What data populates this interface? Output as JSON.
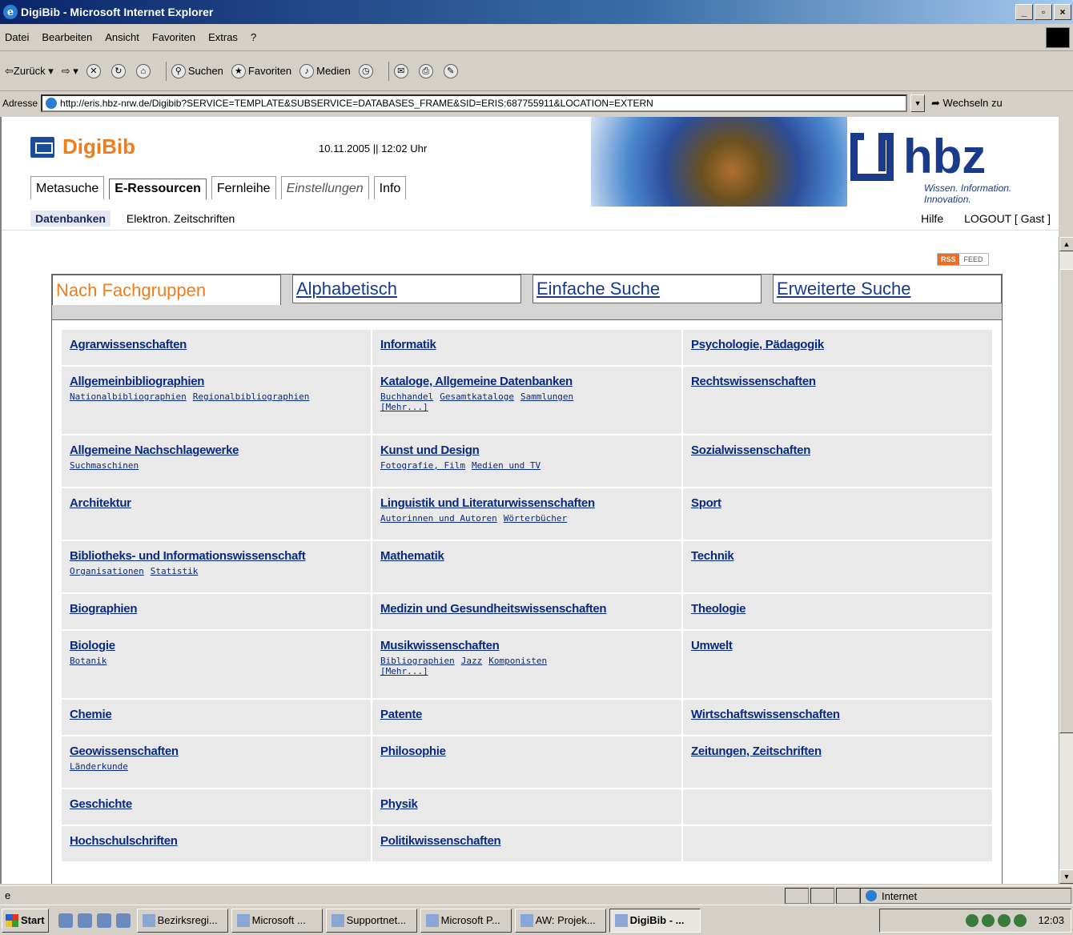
{
  "window": {
    "title": "DigiBib - Microsoft Internet Explorer"
  },
  "menu": [
    "Datei",
    "Bearbeiten",
    "Ansicht",
    "Favoriten",
    "Extras",
    "?"
  ],
  "toolbar": {
    "back": "Zurück",
    "search": "Suchen",
    "favorites": "Favoriten",
    "media": "Medien"
  },
  "address": {
    "label": "Adresse",
    "url": "http://eris.hbz-nrw.de/Digibib?SERVICE=TEMPLATE&SUBSERVICE=DATABASES_FRAME&SID=ERIS:687755911&LOCATION=EXTERN",
    "go": "Wechseln zu"
  },
  "header": {
    "logo": "DigiBib",
    "datetime": "10.11.2005 || 12:02 Uhr",
    "hbz": "hbz",
    "hbz_tagline": "Wissen. Information. Innovation.",
    "tabs": [
      "Metasuche",
      "E-Ressourcen",
      "Fernleihe",
      "Einstellungen",
      "Info"
    ],
    "subnav": [
      "Datenbanken",
      "Elektron. Zeitschriften"
    ],
    "help": "Hilfe",
    "logout": "LOGOUT [ Gast ]"
  },
  "rss": {
    "a": "RSS",
    "b": "FEED"
  },
  "tabs": [
    "Nach Fachgruppen",
    "Alphabetisch",
    "Einfache Suche",
    "Erweiterte Suche"
  ],
  "categories": [
    [
      {
        "name": "Agrarwissenschaften",
        "subs": []
      },
      {
        "name": "Informatik",
        "subs": []
      },
      {
        "name": "Psychologie, Pädagogik",
        "subs": []
      }
    ],
    [
      {
        "name": "Allgemeinbibliographien",
        "subs": [
          "Nationalbibliographien",
          "Regionalbibliographien"
        ]
      },
      {
        "name": "Kataloge, Allgemeine Datenbanken",
        "subs": [
          "Buchhandel",
          "Gesamtkataloge",
          "Sammlungen"
        ],
        "more": "[Mehr...]"
      },
      {
        "name": "Rechtswissenschaften",
        "subs": []
      }
    ],
    [
      {
        "name": "Allgemeine Nachschlagewerke",
        "subs": [
          "Suchmaschinen"
        ]
      },
      {
        "name": "Kunst und Design",
        "subs": [
          "Fotografie, Film",
          "Medien und TV"
        ]
      },
      {
        "name": "Sozialwissenschaften",
        "subs": []
      }
    ],
    [
      {
        "name": "Architektur",
        "subs": []
      },
      {
        "name": "Linguistik und Literaturwissenschaften",
        "subs": [
          "Autorinnen und Autoren",
          "Wörterbücher"
        ]
      },
      {
        "name": "Sport",
        "subs": []
      }
    ],
    [
      {
        "name": "Bibliotheks- und Informationswissenschaft",
        "subs": [
          "Organisationen",
          "Statistik"
        ]
      },
      {
        "name": "Mathematik",
        "subs": []
      },
      {
        "name": "Technik",
        "subs": []
      }
    ],
    [
      {
        "name": "Biographien",
        "subs": []
      },
      {
        "name": "Medizin und Gesundheitswissenschaften",
        "subs": []
      },
      {
        "name": "Theologie",
        "subs": []
      }
    ],
    [
      {
        "name": "Biologie",
        "subs": [
          "Botanik"
        ]
      },
      {
        "name": "Musikwissenschaften",
        "subs": [
          "Bibliographien",
          "Jazz",
          "Komponisten"
        ],
        "more": "[Mehr...]"
      },
      {
        "name": "Umwelt",
        "subs": []
      }
    ],
    [
      {
        "name": "Chemie",
        "subs": []
      },
      {
        "name": "Patente",
        "subs": []
      },
      {
        "name": "Wirtschaftswissenschaften",
        "subs": []
      }
    ],
    [
      {
        "name": "Geowissenschaften",
        "subs": [
          "Länderkunde"
        ]
      },
      {
        "name": "Philosophie",
        "subs": []
      },
      {
        "name": "Zeitungen, Zeitschriften",
        "subs": []
      }
    ],
    [
      {
        "name": "Geschichte",
        "subs": []
      },
      {
        "name": "Physik",
        "subs": []
      },
      {
        "name": "",
        "subs": []
      }
    ],
    [
      {
        "name": "Hochschulschriften",
        "subs": []
      },
      {
        "name": "Politikwissenschaften",
        "subs": []
      },
      {
        "name": "",
        "subs": []
      }
    ]
  ],
  "status": {
    "zone": "Internet"
  },
  "taskbar": {
    "start": "Start",
    "tasks": [
      "Bezirksregi...",
      "Microsoft ...",
      "Supportnet...",
      "Microsoft P...",
      "AW: Projek...",
      "DigiBib - ..."
    ],
    "clock": "12:03"
  }
}
